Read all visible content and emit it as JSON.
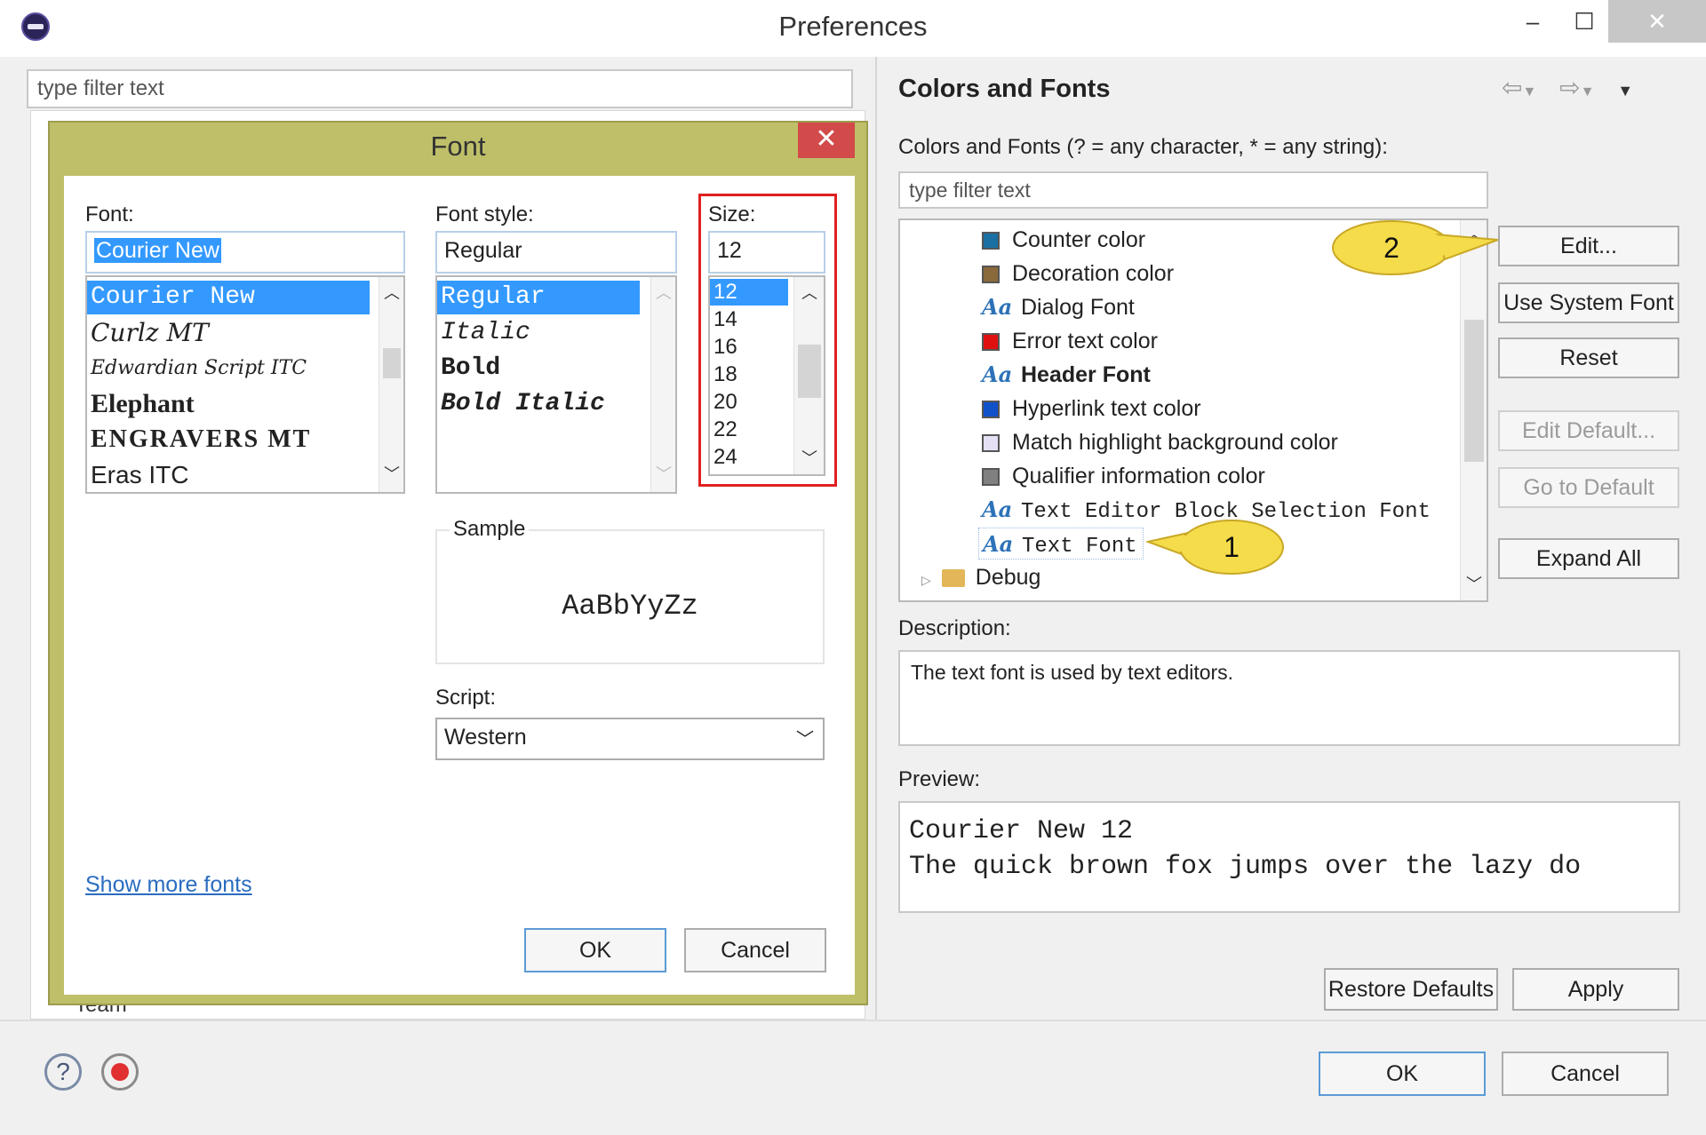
{
  "window": {
    "title": "Preferences",
    "minimize": "–",
    "maximize": "☐",
    "close": "✕"
  },
  "left": {
    "filter_placeholder": "type filter text",
    "behind_item": "Team"
  },
  "font_dialog": {
    "title": "Font",
    "close": "✕",
    "font_label": "Font:",
    "font_value": "Courier New",
    "fonts": [
      "Courier New",
      "Curlz MT",
      "Edwardian Script ITC",
      "Elephant",
      "ENGRAVERS MT",
      "Eras ITC"
    ],
    "style_label": "Font style:",
    "style_value": "Regular",
    "styles": [
      "Regular",
      "Italic",
      "Bold",
      "Bold Italic"
    ],
    "size_label": "Size:",
    "size_value": "12",
    "sizes": [
      "12",
      "14",
      "16",
      "18",
      "20",
      "22",
      "24"
    ],
    "sample_label": "Sample",
    "sample_text": "AaBbYyZz",
    "script_label": "Script:",
    "script_value": "Western",
    "show_more": "Show more fonts",
    "ok": "OK",
    "cancel": "Cancel",
    "highlight_color": "#e02020"
  },
  "right": {
    "title": "Colors and Fonts",
    "filter_label": "Colors and Fonts (? = any character, * = any string):",
    "filter_placeholder": "type filter text",
    "tree": [
      {
        "label": "Counter color",
        "kind": "color",
        "color": "#1a6fa3"
      },
      {
        "label": "Decoration color",
        "kind": "color",
        "color": "#8a6a3a"
      },
      {
        "label": "Dialog Font",
        "kind": "font"
      },
      {
        "label": "Error text color",
        "kind": "color",
        "color": "#e01010"
      },
      {
        "label": "Header Font",
        "kind": "font",
        "bold": true
      },
      {
        "label": "Hyperlink text color",
        "kind": "color",
        "color": "#1050c8"
      },
      {
        "label": "Match highlight background color",
        "kind": "color",
        "color": "#e6e0f5"
      },
      {
        "label": "Qualifier information color",
        "kind": "color",
        "color": "#808080"
      },
      {
        "label": "Text Editor Block Selection Font",
        "kind": "font",
        "mono": true
      },
      {
        "label": "Text Font",
        "kind": "font",
        "mono": true,
        "selected": true
      },
      {
        "label": "Debug",
        "kind": "folder"
      }
    ],
    "aa_glyph": "Aa",
    "buttons": {
      "edit": "Edit...",
      "use_system": "Use System Font",
      "reset": "Reset",
      "edit_default": "Edit Default...",
      "go_default": "Go to Default",
      "expand_all": "Expand All"
    },
    "callout_1": "1",
    "callout_2": "2",
    "description_label": "Description:",
    "description": "The text font is used by text editors.",
    "preview_label": "Preview:",
    "preview_line1": "Courier New 12",
    "preview_line2": "The quick brown fox jumps over the lazy do",
    "restore_defaults": "Restore Defaults",
    "apply": "Apply"
  },
  "bottom": {
    "help": "?",
    "ok": "OK",
    "cancel": "Cancel"
  }
}
